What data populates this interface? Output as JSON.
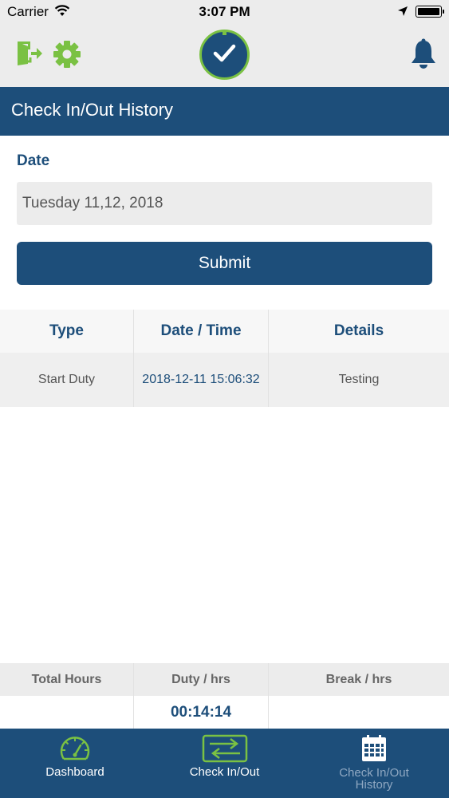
{
  "status_bar": {
    "carrier": "Carrier",
    "time": "3:07 PM"
  },
  "header": {
    "icons": [
      "logout-icon",
      "settings-icon",
      "clock-check-icon",
      "bell-icon"
    ],
    "accent_color": "#7ac143"
  },
  "title_bar": {
    "title": "Check In/Out History",
    "color": "#1d4e7a"
  },
  "form": {
    "date_label": "Date",
    "date_value": "Tuesday 11,12, 2018",
    "submit_label": "Submit"
  },
  "history_table": {
    "columns": [
      "Type",
      "Date / Time",
      "Details"
    ],
    "rows": [
      [
        "Start Duty",
        "2018-12-11 15:06:32",
        "Testing"
      ]
    ]
  },
  "summary": {
    "labels": [
      "Total Hours",
      "Duty / hrs",
      "Break / hrs"
    ],
    "values": [
      "",
      "00:14:14",
      ""
    ]
  },
  "tab_bar": {
    "tabs": [
      {
        "label": "Dashboard",
        "icon": "dashboard-gauge-icon",
        "active": false
      },
      {
        "label": "Check In/Out",
        "icon": "check-in-out-arrows-icon",
        "active": false
      },
      {
        "label": "Check In/Out\nHistory",
        "icon": "calendar-icon",
        "active": true
      }
    ],
    "inactive_label_color": "#ffffff",
    "active_label_color": "#8fa8c2"
  }
}
